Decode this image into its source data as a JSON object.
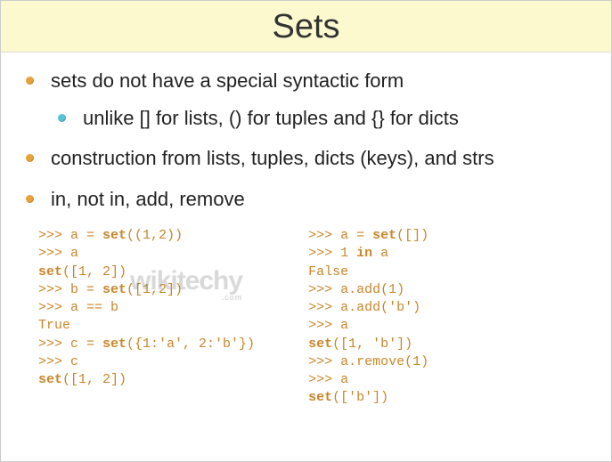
{
  "title": "Sets",
  "bullets": {
    "b1": "sets do not have a special syntactic form",
    "b1a": "unlike [] for lists, () for tuples and {} for dicts",
    "b2": "construction from lists, tuples, dicts (keys), and strs",
    "b3": "in, not in, add, remove"
  },
  "code": {
    "left": {
      "l1a": ">>> a = ",
      "l1b": "set",
      "l1c": "((1,2))",
      "l2": ">>> a",
      "l3a": "set",
      "l3b": "([1, 2])",
      "l4a": ">>> b = ",
      "l4b": "set",
      "l4c": "([1,2])",
      "l5": ">>> a == b",
      "l6": "True",
      "l7a": ">>> c = ",
      "l7b": "set",
      "l7c": "({1:'a', 2:'b'})",
      "l8": ">>> c",
      "l9a": "set",
      "l9b": "([1, 2])"
    },
    "right": {
      "r1a": ">>> a = ",
      "r1b": "set",
      "r1c": "([])",
      "r2a": ">>> 1 ",
      "r2b": "in",
      "r2c": " a",
      "r3": "False",
      "r4": ">>> a.add(1)",
      "r5": ">>> a.add('b')",
      "r6": ">>> a",
      "r7a": "set",
      "r7b": "([1, 'b'])",
      "r8": ">>> a.remove(1)",
      "r9": ">>> a",
      "r10a": "set",
      "r10b": "(['b'])"
    }
  },
  "watermark": {
    "main": "wikitechy",
    "sub": ".com"
  }
}
